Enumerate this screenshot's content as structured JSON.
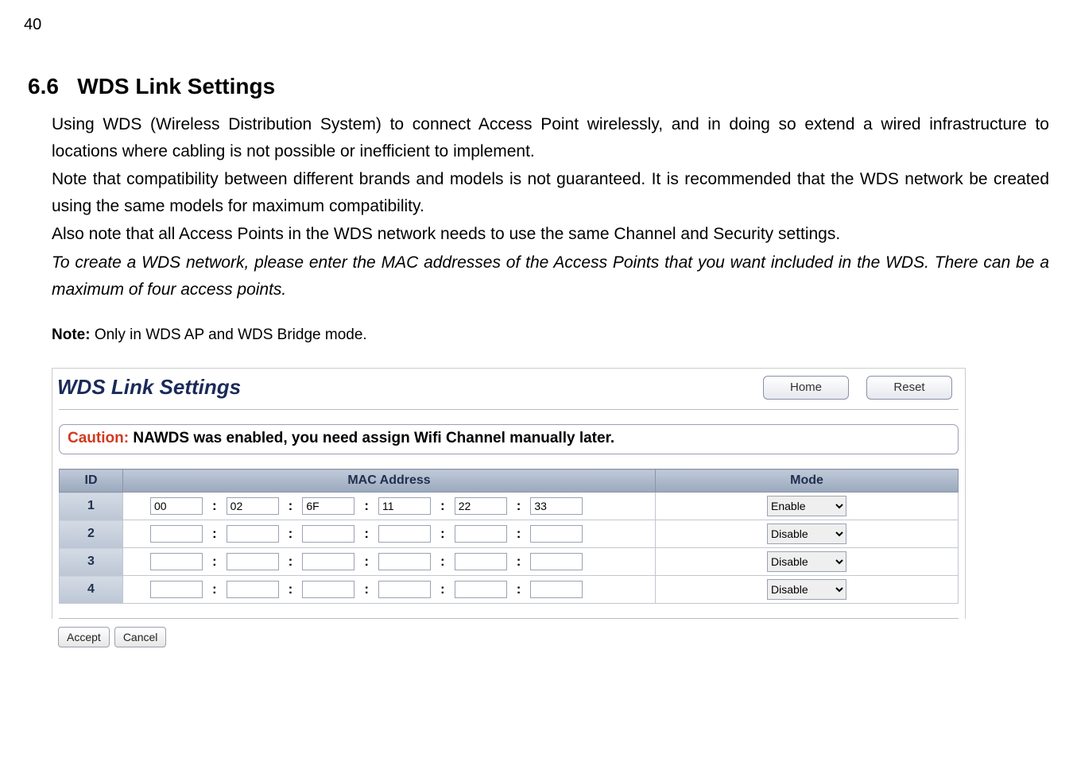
{
  "page_number": "40",
  "section": {
    "number": "6.6",
    "title": "WDS Link Settings"
  },
  "paragraphs": {
    "p1": "Using WDS (Wireless Distribution System) to connect Access Point wirelessly, and in doing so extend a wired infrastructure to locations where cabling is not possible or inefficient to implement.",
    "p2": "Note that compatibility between different brands and models is not guaranteed. It is recommended that the WDS network be created using the same models for maximum compatibility.",
    "p3": "Also note that all Access Points in the WDS network needs to use the same Channel and Security settings.",
    "p4_italic": "To create a WDS network, please enter the MAC addresses of the Access Points that you want included in the WDS. There can be a maximum of four access points.",
    "note_label": "Note:",
    "note_text": " Only in WDS AP and WDS Bridge mode."
  },
  "panel": {
    "title": "WDS Link Settings",
    "home_btn": "Home",
    "reset_btn": "Reset",
    "caution_label": "Caution:",
    "caution_text": "  NAWDS was enabled, you need assign Wifi Channel manually later.",
    "table": {
      "headers": {
        "id": "ID",
        "mac": "MAC Address",
        "mode": "Mode"
      },
      "mode_options": {
        "enable": "Enable",
        "disable": "Disable"
      },
      "rows": [
        {
          "id": "1",
          "mac": [
            "00",
            "02",
            "6F",
            "11",
            "22",
            "33"
          ],
          "mode": "Enable"
        },
        {
          "id": "2",
          "mac": [
            "",
            "",
            "",
            "",
            "",
            ""
          ],
          "mode": "Disable"
        },
        {
          "id": "3",
          "mac": [
            "",
            "",
            "",
            "",
            "",
            ""
          ],
          "mode": "Disable"
        },
        {
          "id": "4",
          "mac": [
            "",
            "",
            "",
            "",
            "",
            ""
          ],
          "mode": "Disable"
        }
      ]
    },
    "accept_btn": "Accept",
    "cancel_btn": "Cancel"
  }
}
